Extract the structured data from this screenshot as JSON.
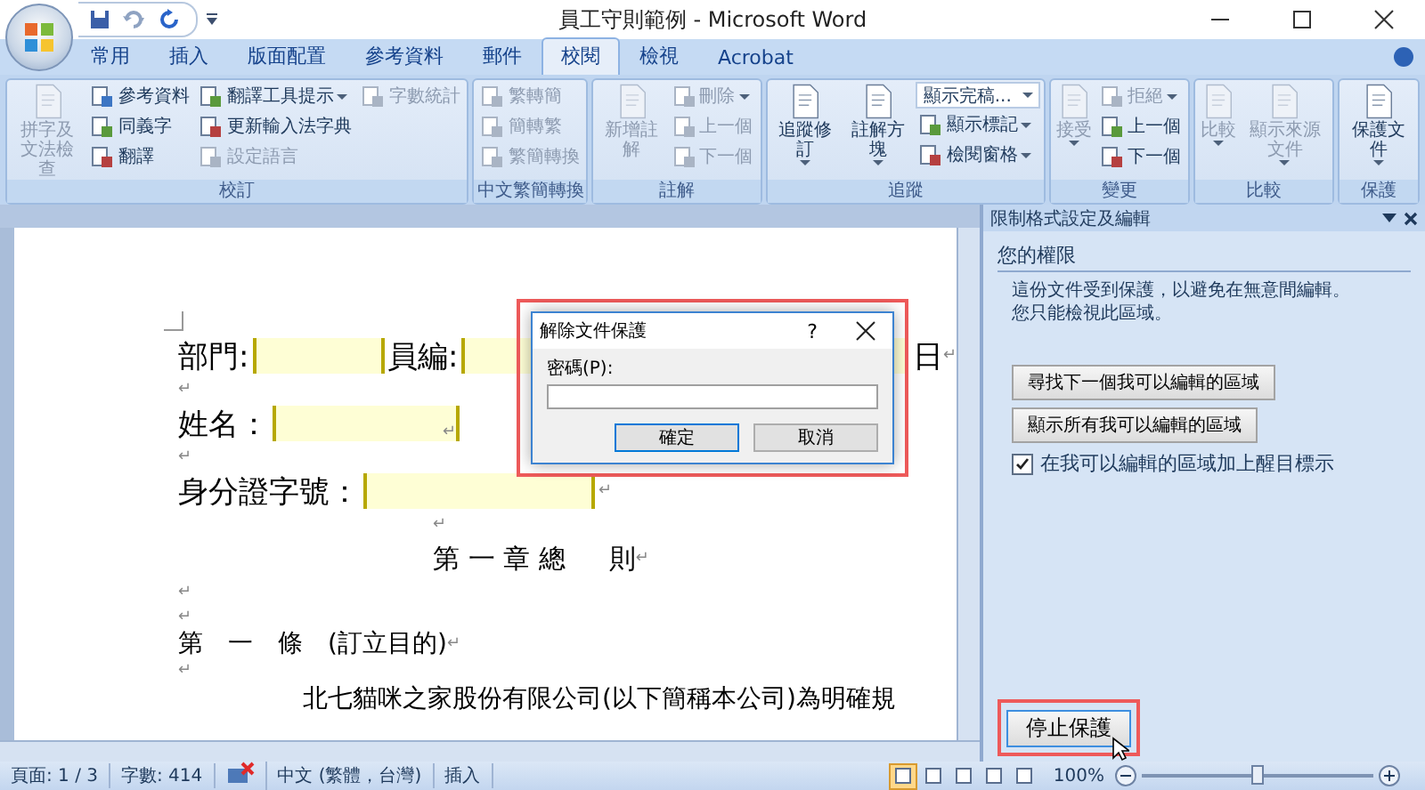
{
  "window": {
    "title": "員工守則範例 - Microsoft Word"
  },
  "tabs": [
    {
      "label": "常用",
      "selected": false
    },
    {
      "label": "插入",
      "selected": false
    },
    {
      "label": "版面配置",
      "selected": false
    },
    {
      "label": "參考資料",
      "selected": false
    },
    {
      "label": "郵件",
      "selected": false
    },
    {
      "label": "校閱",
      "selected": true
    },
    {
      "label": "檢視",
      "selected": false
    },
    {
      "label": "Acrobat",
      "selected": false
    }
  ],
  "ribbon": {
    "groups": [
      {
        "label": "校訂",
        "columns": [
          [
            {
              "kind": "large",
              "label": "拼字及文法檢查",
              "disabled": true,
              "dropdown": false
            }
          ],
          [
            {
              "kind": "small",
              "label": "參考資料",
              "disabled": false,
              "dropdown": false
            },
            {
              "kind": "small",
              "label": "同義字",
              "disabled": false,
              "dropdown": false
            },
            {
              "kind": "small",
              "label": "翻譯",
              "disabled": false,
              "dropdown": false
            }
          ],
          [
            {
              "kind": "small",
              "label": "翻譯工具提示",
              "disabled": false,
              "dropdown": true
            },
            {
              "kind": "small",
              "label": "更新輸入法字典",
              "disabled": false,
              "dropdown": false
            },
            {
              "kind": "small",
              "label": "設定語言",
              "disabled": true,
              "dropdown": false
            }
          ],
          [
            {
              "kind": "small",
              "label": "字數統計",
              "disabled": true,
              "dropdown": false
            }
          ]
        ]
      },
      {
        "label": "中文繁簡轉換",
        "columns": [
          [
            {
              "kind": "small",
              "label": "繁轉簡",
              "disabled": true,
              "dropdown": false
            },
            {
              "kind": "small",
              "label": "簡轉繁",
              "disabled": true,
              "dropdown": false
            },
            {
              "kind": "small",
              "label": "繁簡轉換",
              "disabled": true,
              "dropdown": false
            }
          ]
        ]
      },
      {
        "label": "註解",
        "columns": [
          [
            {
              "kind": "large",
              "label": "新增註解",
              "disabled": true,
              "dropdown": false
            }
          ],
          [
            {
              "kind": "small",
              "label": "刪除",
              "disabled": true,
              "dropdown": true
            },
            {
              "kind": "small",
              "label": "上一個",
              "disabled": true,
              "dropdown": false
            },
            {
              "kind": "small",
              "label": "下一個",
              "disabled": true,
              "dropdown": false
            }
          ]
        ]
      },
      {
        "label": "追蹤",
        "columns": [
          [
            {
              "kind": "large",
              "label": "追蹤修訂",
              "disabled": false,
              "dropdown": true
            }
          ],
          [
            {
              "kind": "large",
              "label": "註解方塊",
              "disabled": false,
              "dropdown": true
            }
          ],
          [
            {
              "kind": "combo",
              "label": "顯示完稿...",
              "disabled": false,
              "dropdown": true
            },
            {
              "kind": "small",
              "label": "顯示標記",
              "disabled": false,
              "dropdown": true
            },
            {
              "kind": "small",
              "label": "檢閱窗格",
              "disabled": false,
              "dropdown": true
            }
          ]
        ]
      },
      {
        "label": "變更",
        "columns": [
          [
            {
              "kind": "large",
              "label": "接受",
              "disabled": true,
              "dropdown": true
            }
          ],
          [
            {
              "kind": "small",
              "label": "拒絕",
              "disabled": true,
              "dropdown": true
            },
            {
              "kind": "small",
              "label": "上一個",
              "disabled": false,
              "dropdown": false
            },
            {
              "kind": "small",
              "label": "下一個",
              "disabled": false,
              "dropdown": false
            }
          ]
        ]
      },
      {
        "label": "比較",
        "columns": [
          [
            {
              "kind": "large",
              "label": "比較",
              "disabled": true,
              "dropdown": true
            }
          ],
          [
            {
              "kind": "large",
              "label": "顯示來源文件",
              "disabled": true,
              "dropdown": true
            }
          ]
        ]
      },
      {
        "label": "保護",
        "columns": [
          [
            {
              "kind": "large",
              "label": "保護文件",
              "disabled": false,
              "dropdown": true
            }
          ]
        ]
      }
    ]
  },
  "document": {
    "lines": [
      {
        "kind": "text",
        "segments": [
          {
            "kind": "text",
            "text": "部門:"
          },
          {
            "kind": "field"
          },
          {
            "kind": "text",
            "text": "員編:"
          },
          {
            "kind": "field"
          },
          {
            "kind": "text",
            "text": "日"
          },
          {
            "kind": "mark",
            "text": "↵"
          }
        ]
      },
      {
        "kind": "blank",
        "segments": [
          {
            "kind": "mark",
            "text": "↵"
          }
        ]
      },
      {
        "kind": "text",
        "segments": [
          {
            "kind": "text",
            "text": "姓名："
          },
          {
            "kind": "field",
            "mark": "↵"
          }
        ]
      },
      {
        "kind": "blank",
        "segments": [
          {
            "kind": "mark",
            "text": "↵"
          }
        ]
      },
      {
        "kind": "text",
        "segments": [
          {
            "kind": "text",
            "text": "身分證字號："
          },
          {
            "kind": "field"
          },
          {
            "kind": "mark",
            "text": "↵"
          }
        ]
      },
      {
        "kind": "blank-center",
        "segments": [
          {
            "kind": "mark",
            "text": "↵"
          }
        ]
      },
      {
        "kind": "heading",
        "segments": [
          {
            "kind": "text",
            "text": "第 一 章 總 　 則"
          },
          {
            "kind": "mark",
            "text": "↵"
          }
        ]
      },
      {
        "kind": "blank",
        "segments": [
          {
            "kind": "mark",
            "text": "↵"
          }
        ]
      },
      {
        "kind": "blank",
        "segments": [
          {
            "kind": "mark",
            "text": "↵"
          }
        ]
      },
      {
        "kind": "article",
        "segments": [
          {
            "kind": "text",
            "text": "第　一　條　(訂立目的)"
          },
          {
            "kind": "mark",
            "text": "↵"
          }
        ]
      },
      {
        "kind": "blank",
        "segments": [
          {
            "kind": "mark",
            "text": "↵"
          }
        ]
      },
      {
        "kind": "paragraph",
        "segments": [
          {
            "kind": "text",
            "text": "北七貓咪之家股份有限公司(以下簡稱本公司)為明確規"
          }
        ]
      }
    ]
  },
  "dialog": {
    "title": "解除文件保護",
    "help": "?",
    "password_label": "密碼(P):",
    "buttons": [
      {
        "label": "確定",
        "default": true
      },
      {
        "label": "取消",
        "default": false
      }
    ],
    "highlighted": true
  },
  "task_pane": {
    "title": "限制格式設定及編輯",
    "section": "您的權限",
    "messages": [
      "這份文件受到保護，以避免在無意間編輯。",
      "您只能檢視此區域。"
    ],
    "buttons": [
      "尋找下一個我可以編輯的區域",
      "顯示所有我可以編輯的區域"
    ],
    "option": {
      "label": "在我可以編輯的區域加上醒目標示",
      "checked": true
    },
    "stop_button": {
      "label": "停止保護",
      "highlighted": true
    }
  },
  "status_bar": {
    "items": [
      "頁面: 1 / 3",
      "字數: 414"
    ],
    "language": "中文 (繁體，台灣)",
    "mode": "插入",
    "views": [
      {
        "selected": true
      },
      {
        "selected": false
      },
      {
        "selected": false
      },
      {
        "selected": false
      },
      {
        "selected": false
      }
    ],
    "zoom": "100%",
    "zoom_slider": {
      "level": 0.5
    }
  }
}
